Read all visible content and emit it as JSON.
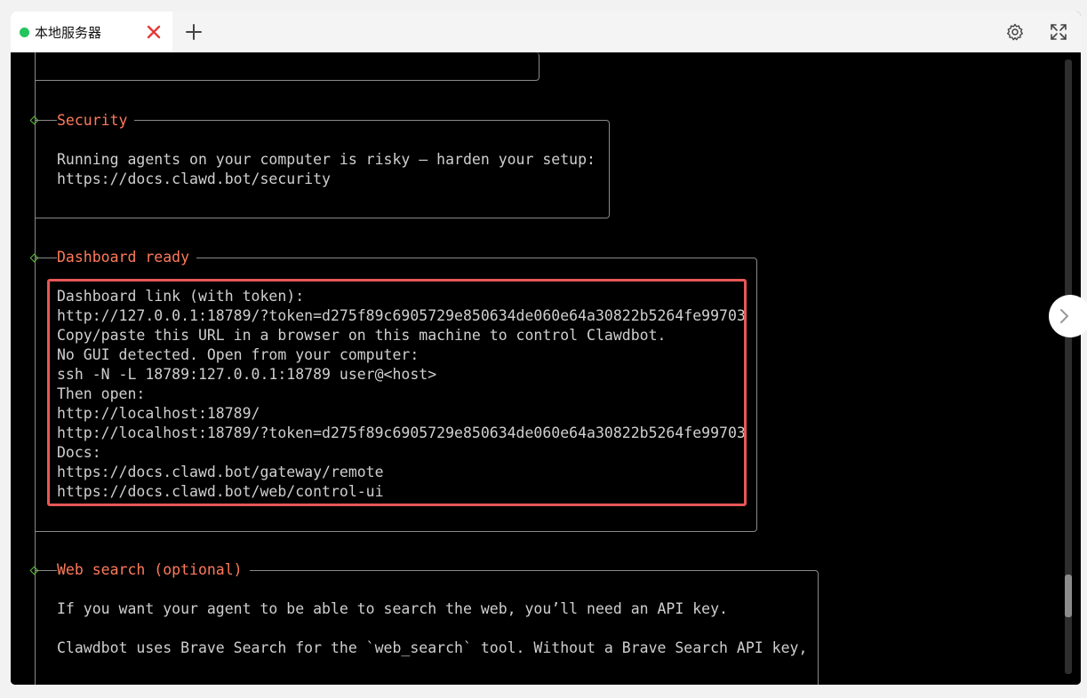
{
  "tab": {
    "label": "本地服务器",
    "status_color": "#22c55e"
  },
  "icons": {
    "close": "close-icon",
    "new_tab": "plus-icon",
    "settings": "gear-icon",
    "fullscreen": "expand-icon",
    "panel_toggle": "chevron-right-icon"
  },
  "colors": {
    "heading": "#ff7a5c",
    "text": "#cfcfcf",
    "diamond": "#5fbf3f",
    "highlight": "#e85757",
    "terminal_bg": "#000000"
  },
  "sections": {
    "security": {
      "title": "Security",
      "lines": [
        "Running agents on your computer is risky — harden your setup:",
        "https://docs.clawd.bot/security"
      ]
    },
    "dashboard": {
      "title": "Dashboard ready",
      "lines": [
        "Dashboard link (with token):",
        "http://127.0.0.1:18789/?token=d275f89c6905729e850634de060e64a30822b5264fe99703",
        "Copy/paste this URL in a browser on this machine to control Clawdbot.",
        "No GUI detected. Open from your computer:",
        "ssh -N -L 18789:127.0.0.1:18789 user@<host>",
        "Then open:",
        "http://localhost:18789/",
        "http://localhost:18789/?token=d275f89c6905729e850634de060e64a30822b5264fe99703",
        "Docs:",
        "https://docs.clawd.bot/gateway/remote",
        "https://docs.clawd.bot/web/control-ui"
      ]
    },
    "web_search": {
      "title": "Web search (optional)",
      "lines": [
        "If you want your agent to be able to search the web, you’ll need an API key.",
        "",
        "Clawdbot uses Brave Search for the `web_search` tool. Without a Brave Search API key,"
      ]
    }
  },
  "scroll": {
    "position": 0.9
  }
}
